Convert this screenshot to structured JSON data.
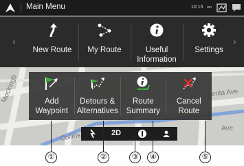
{
  "status_bar": {
    "title": "Main Menu",
    "time": "10:15",
    "ampm": "am",
    "icons": [
      "navigation-arrow-icon",
      "phone-signal-icon",
      "message-icon"
    ]
  },
  "top_menu": {
    "items": [
      {
        "label": "New Route",
        "icon": "route-arrow-icon"
      },
      {
        "label": "My Route",
        "icon": "my-route-icon"
      },
      {
        "label": "Useful\nInformation",
        "icon": "info-icon"
      },
      {
        "label": "Settings",
        "icon": "gear-icon"
      }
    ],
    "prev": "‹",
    "next": "›"
  },
  "sub_menu": {
    "items": [
      {
        "label": "Add\nWaypoint",
        "icon": "add-waypoint-flag-icon"
      },
      {
        "label": "Detours &\nAlternatives",
        "icon": "detour-flag-icon"
      },
      {
        "label": "Route\nSummary",
        "icon": "route-summary-icon"
      },
      {
        "label": "Cancel\nRoute",
        "icon": "cancel-route-icon"
      }
    ]
  },
  "map": {
    "street_labels": [
      "Mockingb",
      "Collins",
      "erita Ave",
      "Ave"
    ]
  },
  "map_controls": {
    "view_mode": "2D",
    "icons": [
      "poi-icon",
      "compass-icon",
      "user-icon"
    ]
  },
  "callouts": [
    "①",
    "②",
    "③",
    "④",
    "⑤"
  ],
  "colors": {
    "status_bar": "#1b1b1b",
    "menu_band": "#2b2b2b",
    "submenu": "#373737",
    "icon_green": "#3fae3f",
    "icon_red": "#d8322e"
  }
}
